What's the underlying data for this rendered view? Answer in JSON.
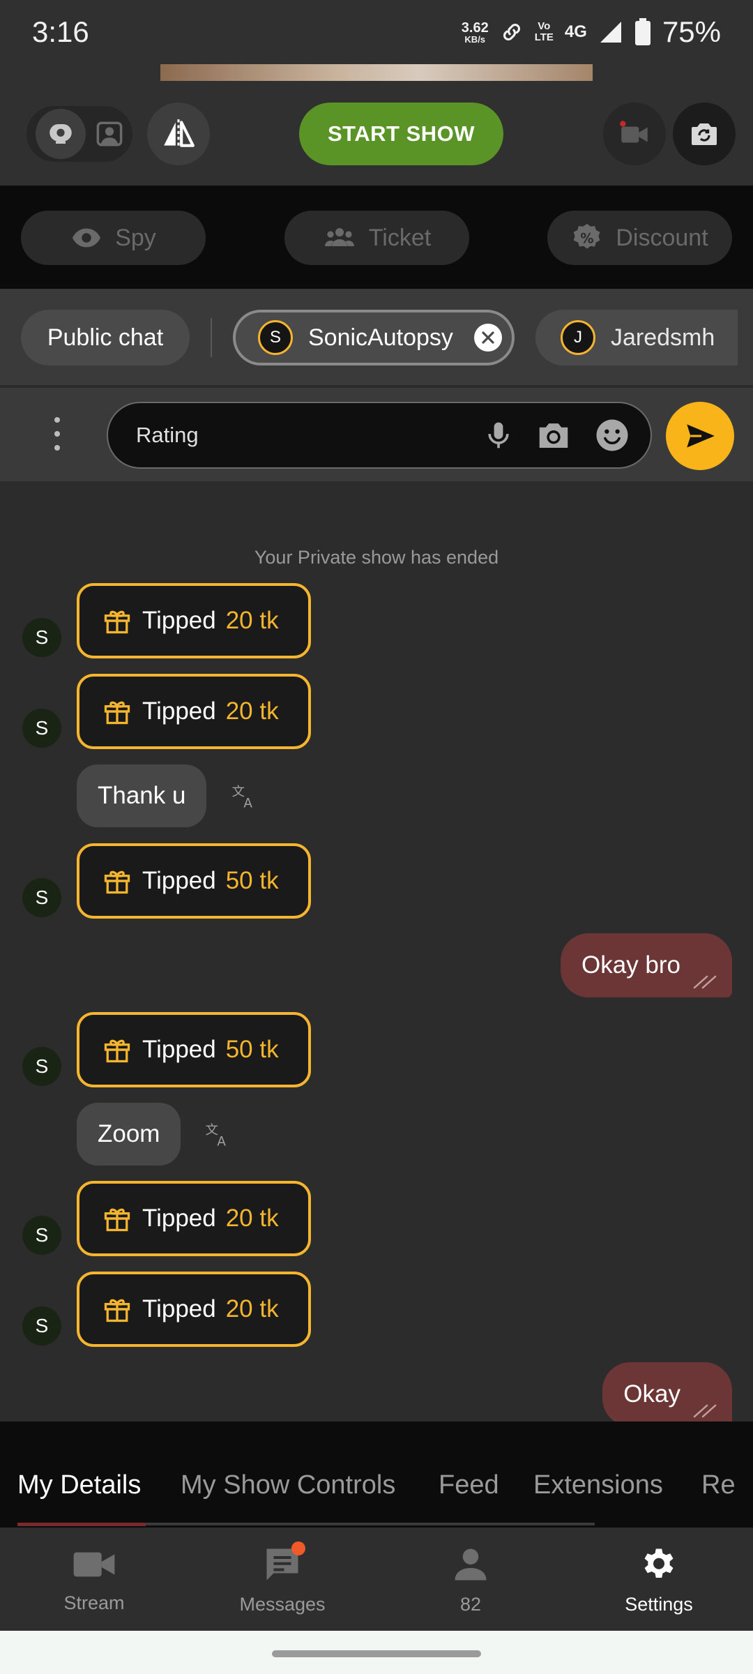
{
  "status_bar": {
    "time": "3:16",
    "speed_value": "3.62",
    "speed_unit": "KB/s",
    "volte_top": "Vo",
    "volte_bottom": "LTE",
    "network": "4G",
    "battery": "75%"
  },
  "controls": {
    "start_show_label": "START SHOW"
  },
  "options": {
    "spy_label": "Spy",
    "ticket_label": "Ticket",
    "discount_label": "Discount"
  },
  "chat_tabs": {
    "public_label": "Public chat",
    "active_initial": "S",
    "active_name": "SonicAutopsy",
    "other_initial": "J",
    "other_name": "Jaredsmh"
  },
  "input": {
    "value": "Rating"
  },
  "chat": {
    "system_message": "Your Private show has ended",
    "sender_initial": "S",
    "tipped_word": "Tipped",
    "tips": [
      {
        "amount": "20 tk"
      },
      {
        "amount": "20 tk"
      },
      {
        "amount": "50 tk"
      },
      {
        "amount": "50 tk"
      },
      {
        "amount": "20 tk"
      },
      {
        "amount": "20 tk"
      }
    ],
    "incoming": [
      "Thank u",
      "Zoom"
    ],
    "outgoing": [
      "Okay bro",
      "Okay"
    ]
  },
  "section_tabs": [
    "My Details",
    "My Show Controls",
    "Feed",
    "Extensions",
    "Re"
  ],
  "bottom_nav": {
    "stream": "Stream",
    "messages": "Messages",
    "viewers": "82",
    "settings": "Settings"
  },
  "colors": {
    "accent_yellow": "#f5b52e",
    "start_green": "#5a9326",
    "outgoing_bubble": "#6d3636",
    "badge_orange": "#f05a28"
  }
}
